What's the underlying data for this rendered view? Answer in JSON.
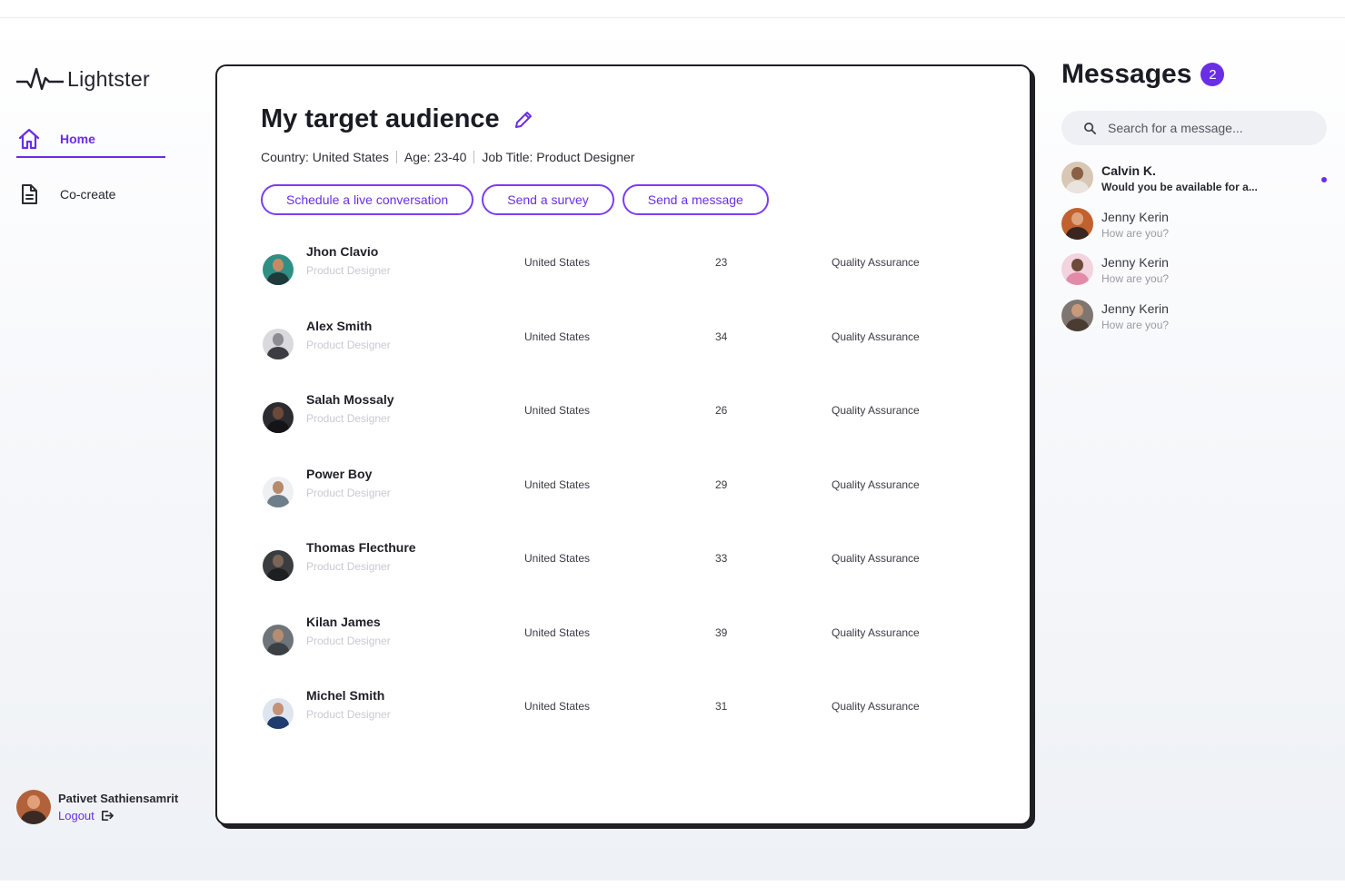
{
  "app": {
    "brand": "Lightster"
  },
  "sidebar": {
    "items": [
      {
        "label": "Home",
        "icon": "home-icon",
        "active": true
      },
      {
        "label": "Co-create",
        "icon": "document-icon",
        "active": false
      }
    ],
    "user": {
      "name": "Pativet Sathiensamrit",
      "logout_label": "Logout"
    }
  },
  "main": {
    "title": "My target audience",
    "filters": [
      "Country: United States",
      "Age: 23-40",
      "Job Title: Product Designer"
    ],
    "actions": [
      "Schedule a live conversation",
      "Send a survey",
      "Send a message"
    ],
    "rows": [
      {
        "name": "Jhon Clavio",
        "role": "Product Designer",
        "country": "United States",
        "age": "23",
        "dept": "Quality Assurance"
      },
      {
        "name": "Alex Smith",
        "role": "Product Designer",
        "country": "United States",
        "age": "34",
        "dept": "Quality Assurance"
      },
      {
        "name": "Salah Mossaly",
        "role": "Product Designer",
        "country": "United States",
        "age": "26",
        "dept": "Quality Assurance"
      },
      {
        "name": "Power Boy",
        "role": "Product Designer",
        "country": "United States",
        "age": "29",
        "dept": "Quality Assurance"
      },
      {
        "name": "Thomas Flecthure",
        "role": "Product Designer",
        "country": "United States",
        "age": "33",
        "dept": "Quality Assurance"
      },
      {
        "name": "Kilan James",
        "role": "Product Designer",
        "country": "United States",
        "age": "39",
        "dept": "Quality Assurance"
      },
      {
        "name": "Michel Smith",
        "role": "Product Designer",
        "country": "United States",
        "age": "31",
        "dept": "Quality Assurance"
      }
    ]
  },
  "messages": {
    "title": "Messages",
    "badge": "2",
    "search_placeholder": "Search for a message...",
    "items": [
      {
        "name": "Calvin K.",
        "text": "Would you be available for a...",
        "unread": true
      },
      {
        "name": "Jenny Kerin",
        "text": "How are you?",
        "unread": false
      },
      {
        "name": "Jenny Kerin",
        "text": "How are you?",
        "unread": false
      },
      {
        "name": "Jenny Kerin",
        "text": "How are you?",
        "unread": false
      }
    ]
  },
  "colors": {
    "accent": "#6a2ee6",
    "border": "#1f1f24",
    "muted": "#c9c9d2"
  }
}
